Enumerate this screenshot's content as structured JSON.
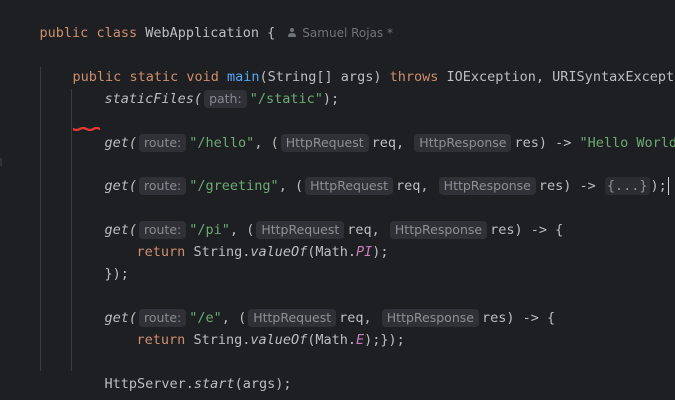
{
  "header": {
    "declaration": {
      "keyword_public": "public",
      "keyword_class": "class",
      "class_name": "WebApplication",
      "open_brace": "{"
    },
    "author": "Samuel Rojas *"
  },
  "main_method": {
    "public": "public",
    "static": "static",
    "void": "void",
    "name": "main",
    "params": "(String[] args)",
    "throws": "throws",
    "exceptions": "IOException, URISyntaxException",
    "open_brace": "{"
  },
  "static_files": {
    "call": "staticFiles(",
    "hint": "path:",
    "value": "\"/static\"",
    "end": ");"
  },
  "hello_route": {
    "call": "get(",
    "route_hint": "route:",
    "path": "\"/hello\"",
    "comma": ",",
    "open_paren": " (",
    "req_type": "HttpRequest",
    "req": "req,",
    "res_type": "HttpResponse",
    "res": "res) ->",
    "body": "\"Hello World!\"",
    "end": ");"
  },
  "greeting_route": {
    "call": "get(",
    "route_hint": "route:",
    "path": "\"/greeting\"",
    "comma": ",",
    "open_paren": " (",
    "req_type": "HttpRequest",
    "req": "req,",
    "res_type": "HttpResponse",
    "res": "res) ->",
    "folded": "{...}",
    "end": ");"
  },
  "pi_route": {
    "call": "get(",
    "route_hint": "route:",
    "path": "\"/pi\"",
    "comma": ",",
    "open_paren": " (",
    "req_type": "HttpRequest",
    "req": "req,",
    "res_type": "HttpResponse",
    "res": "res) -> {",
    "return_kw": "return",
    "string_class": "String.",
    "value_of": "valueOf",
    "math_open": "(Math.",
    "constant": "PI",
    "statement_end": ");",
    "close": "});"
  },
  "e_route": {
    "call": "get(",
    "route_hint": "route:",
    "path": "\"/e\"",
    "comma": ",",
    "open_paren": " (",
    "req_type": "HttpRequest",
    "req": "req,",
    "res_type": "HttpResponse",
    "res": "res) -> {",
    "return_kw": "return",
    "string_class": "String.",
    "value_of": "valueOf",
    "math_open": "(Math.",
    "constant": "E",
    "statement_end": ");});"
  },
  "server": {
    "object": "HttpServer.",
    "method": "start",
    "args": "(args);"
  },
  "closing_brace": "}",
  "colors": {
    "background": "#1e1f22",
    "keyword": "#cf8e6d",
    "method": "#56a8f5",
    "string": "#6aab73",
    "static_constant": "#c77dbb",
    "inlay_hint_background": "#2f3136",
    "inlay_hint_text": "#868a91",
    "squiggle": "#e53935"
  },
  "icons": {
    "author": "person-icon",
    "error_marker": "red-squiggle-underline"
  }
}
